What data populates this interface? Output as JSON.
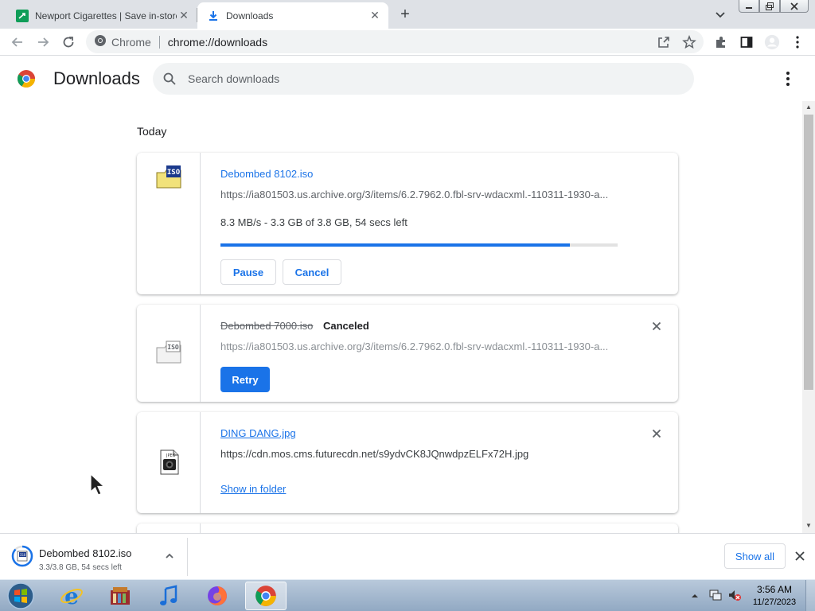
{
  "browser": {
    "tabs": [
      {
        "title": "Newport Cigarettes | Save in-store"
      },
      {
        "title": "Downloads"
      }
    ],
    "omnibox": {
      "site": "Chrome",
      "url": "chrome://downloads"
    }
  },
  "header": {
    "title": "Downloads",
    "search_placeholder": "Search downloads"
  },
  "list": {
    "section": "Today",
    "items": [
      {
        "name": "Debombed 8102.iso",
        "url": "https://ia801503.us.archive.org/3/items/6.2.7962.0.fbl-srv-wdacxml.-110311-1930-a...",
        "progress_text": "8.3 MB/s - 3.3 GB of 3.8 GB, 54 secs left",
        "progress": 0.88,
        "pause_label": "Pause",
        "cancel_label": "Cancel",
        "icon": "iso-file-icon"
      },
      {
        "name": "Debombed 7000.iso",
        "status": "Canceled",
        "url": "https://ia801503.us.archive.org/3/items/6.2.7962.0.fbl-srv-wdacxml.-110311-1930-a...",
        "retry_label": "Retry",
        "icon": "iso-file-icon"
      },
      {
        "name": "DING DANG.jpg",
        "url": "https://cdn.mos.cms.futurecdn.net/s9ydvCK8JQnwdpzELFx72H.jpg",
        "show_in_folder_label": "Show in folder",
        "icon": "jpeg-file-icon"
      }
    ]
  },
  "shelf": {
    "item_name": "Debombed 8102.iso",
    "item_status": "3.3/3.8 GB, 54 secs left",
    "progress": 0.87,
    "show_all_label": "Show all"
  },
  "taskbar": {
    "time": "3:56 AM",
    "date": "11/27/2023",
    "apps": [
      "internet-explorer-icon",
      "library-icon",
      "music-icon",
      "firefox-icon",
      "chrome-icon"
    ]
  },
  "colors": {
    "accent": "#1a73e8",
    "tabstrip": "#dee1e6",
    "omnibox": "#f1f3f4"
  }
}
